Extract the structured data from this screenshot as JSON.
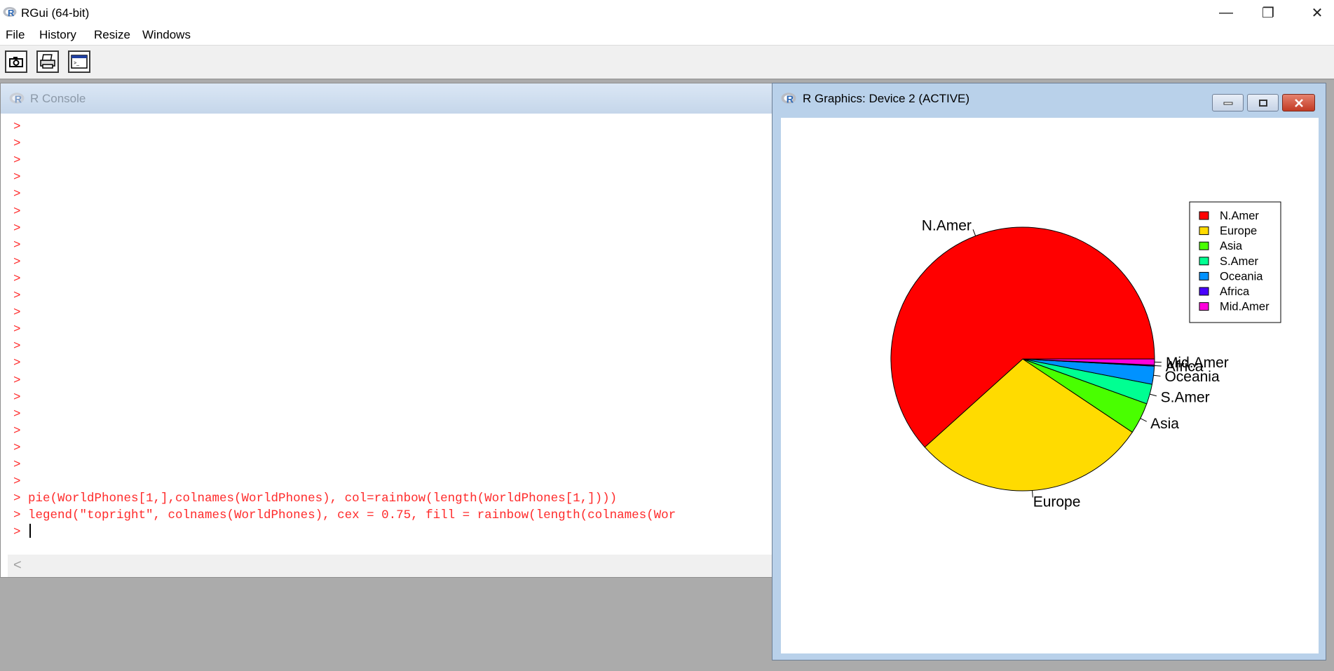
{
  "app": {
    "title": "RGui (64-bit)"
  },
  "window_controls": {
    "minimize": "—",
    "restore": "❐",
    "close": "✕"
  },
  "menu": [
    "File",
    "History",
    "Resize",
    "Windows"
  ],
  "toolbar": {
    "buttons": [
      "camera-icon",
      "print-icon",
      "console-icon"
    ]
  },
  "console": {
    "title": "R Console",
    "empty_prompts": 22,
    "prompt": ">",
    "lines": [
      "pie(WorldPhones[1,],colnames(WorldPhones), col=rainbow(length(WorldPhones[1,])))",
      "legend(\"topright\", colnames(WorldPhones), cex = 0.75, fill = rainbow(length(colnames(Wor"
    ],
    "scroll_left": "<"
  },
  "graphics": {
    "title": "R Graphics: Device 2 (ACTIVE)",
    "buttons": [
      "minimize",
      "maximize",
      "close"
    ]
  },
  "chart_data": {
    "type": "pie",
    "categories": [
      "N.Amer",
      "Europe",
      "Asia",
      "S.Amer",
      "Oceania",
      "Africa",
      "Mid.Amer"
    ],
    "values": [
      45939,
      21574,
      2876,
      1815,
      1646,
      89,
      555
    ],
    "colors": [
      "#FF0000",
      "#FFDB00",
      "#49FF00",
      "#00FF92",
      "#0092FF",
      "#4900FF",
      "#FF00DB"
    ],
    "legend": {
      "position": "topright",
      "entries": [
        "N.Amer",
        "Europe",
        "Asia",
        "S.Amer",
        "Oceania",
        "Africa",
        "Mid.Amer"
      ]
    }
  }
}
